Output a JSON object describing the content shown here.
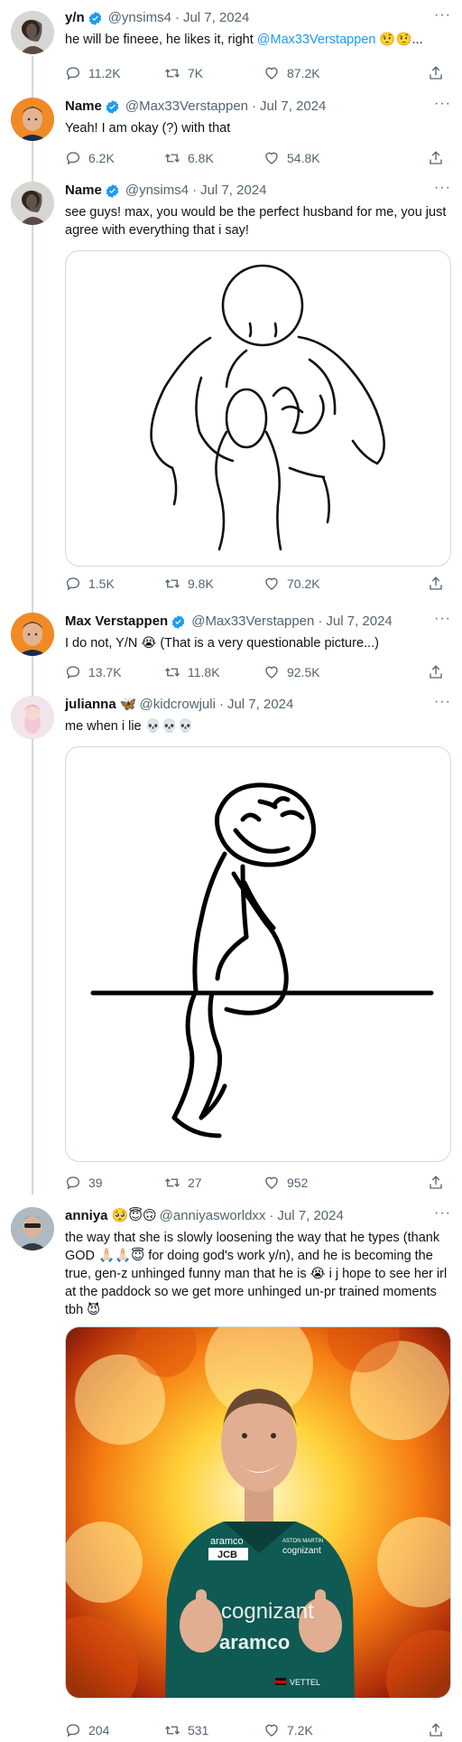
{
  "tweets": [
    {
      "name": "y/n",
      "handle": "@ynsims4",
      "date": "Jul 7, 2024",
      "text_before": "he will be fineee, he likes it, right ",
      "mention": "@Max33Verstappen",
      "text_after": " 🤨🤨...",
      "replies": "11.2K",
      "retweets": "7K",
      "likes": "87.2K"
    },
    {
      "name": "Name",
      "handle": "@Max33Verstappen",
      "date": "Jul 7, 2024",
      "text": "Yeah! I am okay (?) with that",
      "replies": "6.2K",
      "retweets": "6.8K",
      "likes": "54.8K"
    },
    {
      "name": "Name",
      "handle": "@ynsims4",
      "date": "Jul 7, 2024",
      "text": "see guys! max, you would be the perfect husband for me, you just agree with everything that i say!",
      "replies": "1.5K",
      "retweets": "9.8K",
      "likes": "70.2K"
    },
    {
      "name": "Max Verstappen",
      "handle": "@Max33Verstappen",
      "date": "Jul 7, 2024",
      "text": "I do not, Y/N 😭 (That is a very questionable picture...)",
      "replies": "13.7K",
      "retweets": "11.8K",
      "likes": "92.5K"
    },
    {
      "name": "julianna 🦋",
      "handle": "@kidcrowjuli",
      "date": "Jul 7, 2024",
      "text": "me when i lie 💀💀💀",
      "replies": "39",
      "retweets": "27",
      "likes": "952"
    },
    {
      "name": "anniya 🥺😇🙃",
      "handle": "@anniyasworldxx",
      "date": "Jul 7, 2024",
      "text": "the way that she is slowly loosening the way that he types (thank GOD 🙏🏻🙏🏻😇 for doing god's work y/n), and he is becoming the true, gen-z unhinged funny man that he is 😭 i j hope to see her irl at the paddock so we get more unhinged un-pr trained moments tbh 😈",
      "replies": "204",
      "retweets": "531",
      "likes": "7.2K"
    }
  ],
  "photo_text": {
    "chest_a": "aramco",
    "chest_b": "JCB",
    "chest_c": "cognizant",
    "belt_a": "cognizant",
    "belt_b": "aramco",
    "sleeve": "VETTEL",
    "logo_small": "ASTON MARTIN"
  },
  "colors": {
    "verified": "#1d9bf0",
    "link": "#1d9bf0",
    "muted": "#536471",
    "border": "#cfd9de"
  },
  "icons": {
    "more": "···"
  }
}
